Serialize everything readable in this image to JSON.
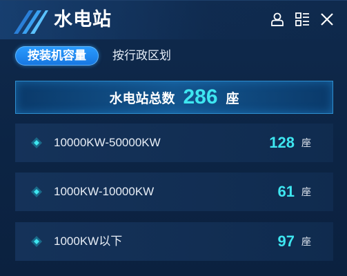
{
  "header": {
    "title": "水电站",
    "icons": [
      "user-icon",
      "list-icon",
      "close-icon"
    ]
  },
  "tabs": [
    {
      "label": "按装机容量",
      "active": true
    },
    {
      "label": "按行政区划",
      "active": false
    }
  ],
  "total": {
    "label": "水电站总数",
    "value": "286",
    "unit": "座"
  },
  "rows": [
    {
      "label": "10000KW-50000KW",
      "value": "128",
      "unit": "座"
    },
    {
      "label": "1000KW-10000KW",
      "value": "61",
      "unit": "座"
    },
    {
      "label": "1000KW以下",
      "value": "97",
      "unit": "座"
    }
  ],
  "colors": {
    "accent": "#3ee6f0",
    "tab_active": "#1f8cf0",
    "background": "#0c2444"
  }
}
